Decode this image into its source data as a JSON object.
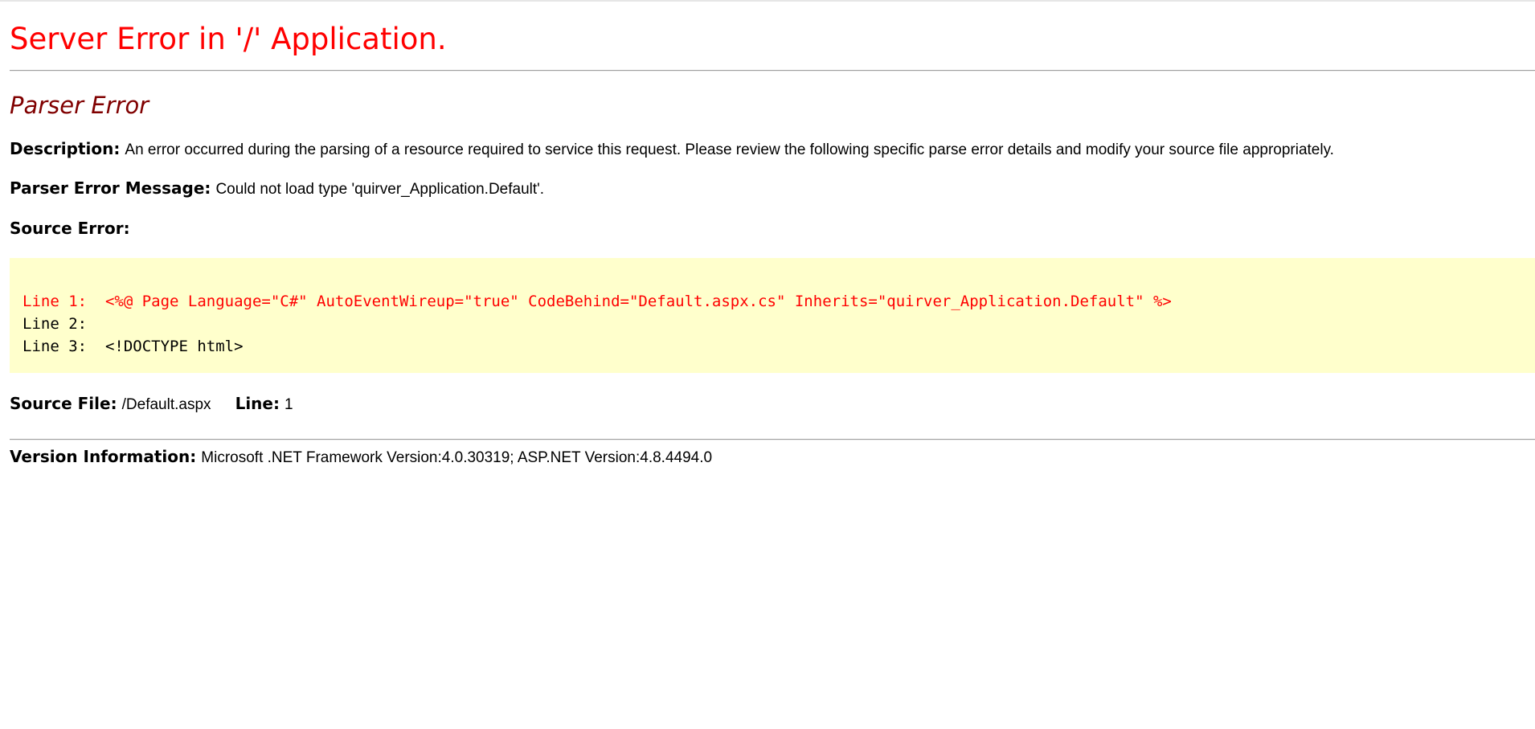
{
  "page": {
    "title": "Server Error in '/' Application.",
    "error_title": "Parser Error"
  },
  "description": {
    "label": "Description:",
    "text": "An error occurred during the parsing of a resource required to service this request. Please review the following specific parse error details and modify your source file appropriately."
  },
  "parser_message": {
    "label": "Parser Error Message:",
    "text": "Could not load type 'quirver_Application.Default'."
  },
  "source_error": {
    "label": "Source Error:",
    "lines": [
      {
        "text": "Line 1:  <%@ Page Language=\"C#\" AutoEventWireup=\"true\" CodeBehind=\"Default.aspx.cs\" Inherits=\"quirver_Application.Default\" %>",
        "highlight": true
      },
      {
        "text": "Line 2:",
        "highlight": false
      },
      {
        "text": "Line 3:  <!DOCTYPE html>",
        "highlight": false
      }
    ]
  },
  "source_file": {
    "label": "Source File:",
    "value": "/Default.aspx",
    "line_label": "Line:",
    "line_value": "1"
  },
  "version": {
    "label": "Version Information:",
    "text": "Microsoft .NET Framework Version:4.0.30319; ASP.NET Version:4.8.4494.0"
  },
  "colors": {
    "title": "#ff0000",
    "error_title": "#800000",
    "code_background": "#ffffcc",
    "code_error_line": "#ff0000"
  }
}
